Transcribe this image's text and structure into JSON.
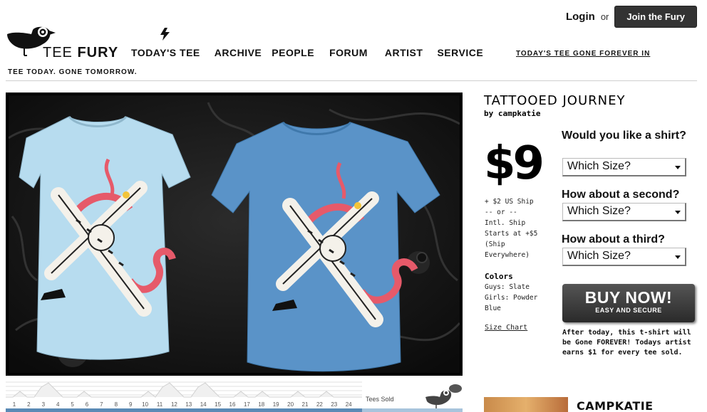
{
  "auth": {
    "login_label": "Login",
    "or_label": "or",
    "join_label": "Join the Fury"
  },
  "brand": {
    "name_light": "TEE",
    "name_bold": "FURY",
    "tagline": "TEE TODAY. GONE TOMORROW."
  },
  "nav": {
    "items": [
      {
        "label": "TODAY'S TEE"
      },
      {
        "label": "ARCHIVE"
      },
      {
        "label": "PEOPLE"
      },
      {
        "label": "FORUM"
      },
      {
        "label": "ARTIST"
      },
      {
        "label": "SERVICE"
      }
    ],
    "countdown_label": "TODAY'S TEE GONE FOREVER IN"
  },
  "product": {
    "title": "TATTOOED JOURNEY",
    "byline": "by campkatie",
    "price": "$9",
    "shipping": [
      "+ $2 US Ship",
      "-- or --",
      "Intl. Ship",
      "Starts at +$5",
      "(Ship",
      "Everywhere)"
    ],
    "colors_heading": "Colors",
    "colors": [
      "Guys: Slate",
      "Girls: Powder",
      "Blue"
    ],
    "size_chart_label": "Size Chart",
    "shirt_colors": {
      "girls": "#b7dcef",
      "guys": "#5a93c8"
    }
  },
  "order": {
    "questions": [
      {
        "label": "Would you like a shirt?",
        "selected": "Which Size?"
      },
      {
        "label": "How about a second?",
        "selected": "Which Size?"
      },
      {
        "label": "How about a third?",
        "selected": "Which Size?"
      }
    ],
    "buy_label": "BUY NOW!",
    "buy_sub": "EASY AND SECURE",
    "note": "After today, this t-shirt will be Gone FOREVER! Todays artist earns $1 for every tee sold."
  },
  "sales": {
    "hour_labels": [
      "1",
      "2",
      "3",
      "4",
      "5",
      "6",
      "7",
      "8",
      "9",
      "10",
      "11",
      "12",
      "13",
      "14",
      "15",
      "16",
      "17",
      "18",
      "19",
      "20",
      "21",
      "22",
      "23",
      "24"
    ],
    "tees_sold_label": "Tees Sold"
  },
  "artist": {
    "name": "CAMPKATIE"
  },
  "colors": {
    "dark": "#333333",
    "rule": "#cfcfcf",
    "chart_bar": "#5a8ab5"
  }
}
